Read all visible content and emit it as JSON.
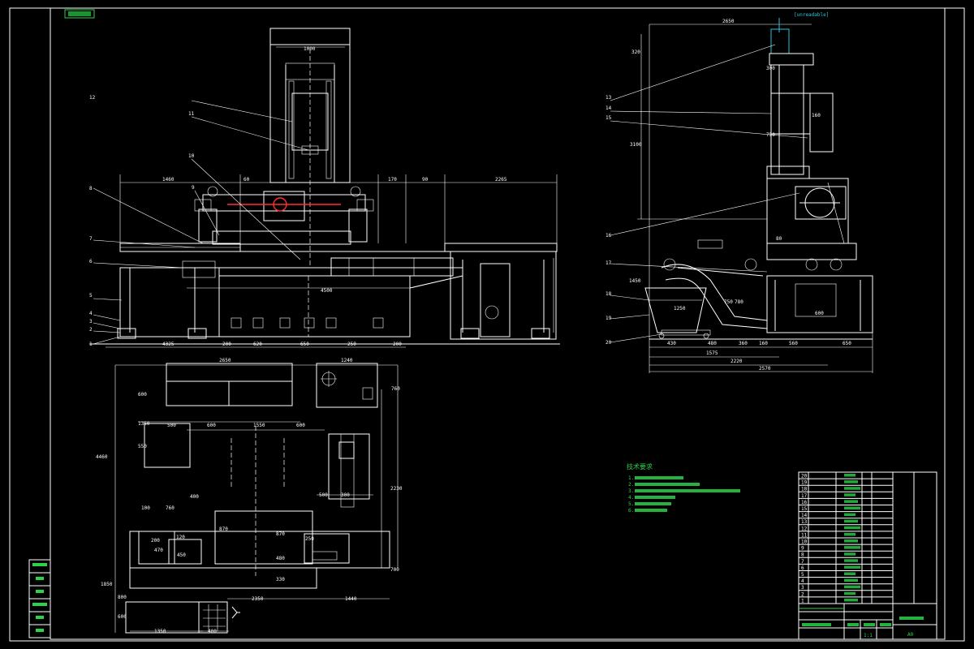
{
  "drawing": {
    "corner_stamp": "",
    "colors": {
      "background": "#000000",
      "lines": "#ffffff",
      "text_green": "#2bd24a",
      "leader_cyan": "#25c8d8",
      "axis_red": "#ff3030"
    }
  },
  "front_view": {
    "dims_top": [
      "1460",
      "60",
      "170",
      "90",
      "2265"
    ],
    "dim_column": "1000",
    "dims_mid": [
      "4500"
    ],
    "dims_bottom": [
      "4325",
      "200",
      "620",
      "650",
      "250",
      "200"
    ],
    "dim_right": "[blank]",
    "leaders": [
      "12",
      "11",
      "10",
      "9",
      "8",
      "7",
      "6",
      "5",
      "4",
      "3",
      "2",
      "1"
    ]
  },
  "side_view": {
    "dims_top": [
      "2650",
      "320",
      "300"
    ],
    "dim_height": "3100",
    "dims_mid": [
      "1450",
      "1250",
      "750",
      "780",
      "600",
      "80",
      "750",
      "160"
    ],
    "dims_bottom": [
      "430",
      "480",
      "360",
      "160",
      "560",
      "650",
      "1575",
      "2220",
      "2570"
    ],
    "leaders": [
      "13",
      "14",
      "15",
      "16",
      "17",
      "18",
      "19",
      "20"
    ],
    "cyan_note": "[unreadable]"
  },
  "plan_view": {
    "dims": [
      "2650",
      "1240",
      "760",
      "600",
      "1350",
      "500",
      "600",
      "1550",
      "600",
      "4460",
      "2230",
      "400",
      "500",
      "300",
      "760",
      "100",
      "550",
      "870",
      "870",
      "480",
      "200",
      "470",
      "120",
      "450",
      "250",
      "330",
      "2350",
      "1440",
      "1850",
      "700",
      "1350",
      "400",
      "800",
      "600"
    ]
  },
  "tech_notes": {
    "title": "技术要求",
    "items": [
      "1.",
      "2.",
      "3.",
      "4.",
      "5.",
      "6."
    ]
  },
  "bom": {
    "rows": [
      "20",
      "19",
      "18",
      "17",
      "16",
      "15",
      "14",
      "13",
      "12",
      "11",
      "10",
      "9",
      "8",
      "7",
      "6",
      "5",
      "4",
      "3",
      "2",
      "1"
    ]
  },
  "title_block": {
    "scale": "1:1",
    "sheet_no": "A0"
  },
  "left_strip": {
    "cells": [
      "",
      "",
      "",
      "",
      "",
      ""
    ]
  }
}
